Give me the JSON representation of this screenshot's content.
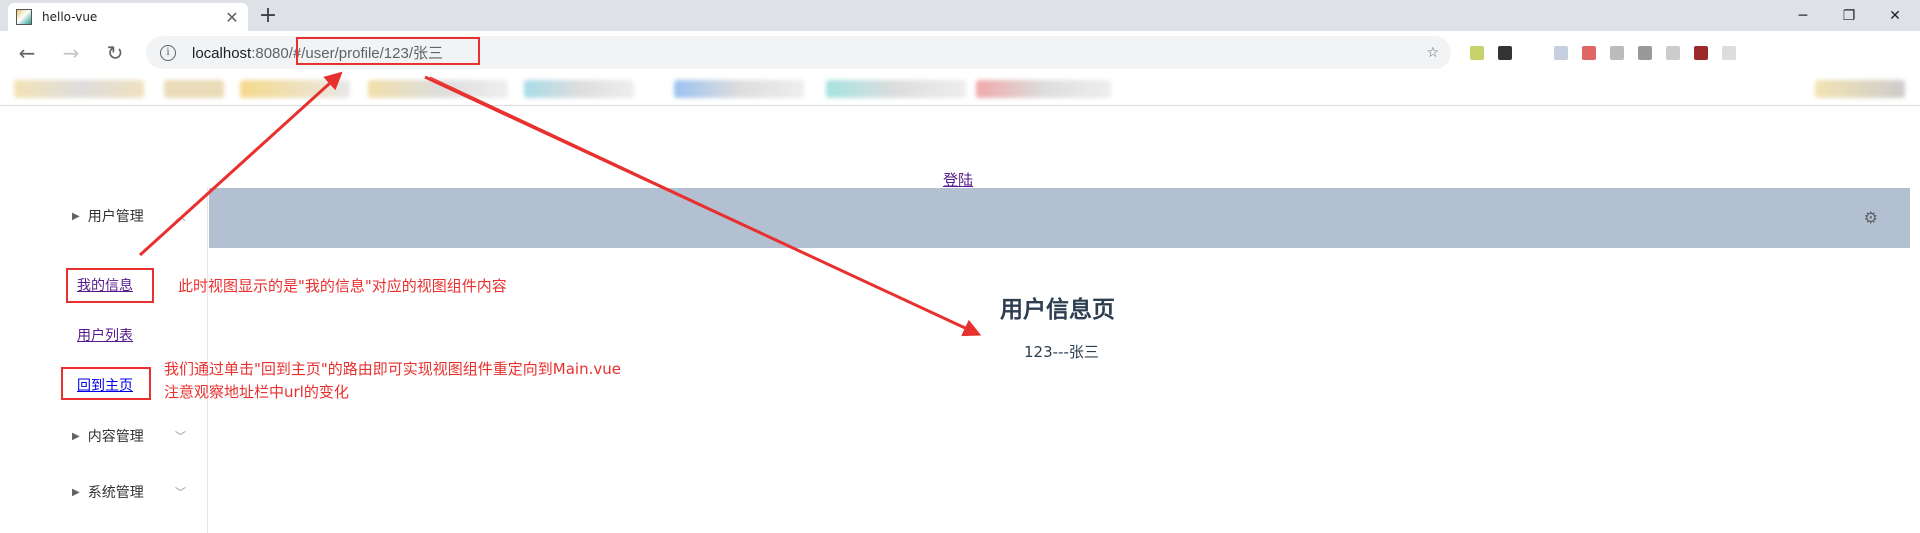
{
  "browser": {
    "tab_title": "hello-vue",
    "tab_close": "✕",
    "new_tab": "+",
    "window_minimize": "─",
    "window_restore": "❐",
    "window_close": "✕",
    "back": "←",
    "forward": "→",
    "reload": "↻",
    "info": "i",
    "url_host": "localhost",
    "url_port": ":8080/",
    "url_path": "#/user/profile/123/张三",
    "bookmark_star": "☆"
  },
  "app": {
    "login_link": "登陆",
    "sidebar": {
      "groups": [
        {
          "label": "用户管理",
          "expanded": true
        },
        {
          "label": "内容管理",
          "expanded": false
        },
        {
          "label": "系统管理",
          "expanded": false
        }
      ],
      "links": [
        {
          "label": "我的信息"
        },
        {
          "label": "用户列表"
        },
        {
          "label": "回到主页"
        }
      ]
    },
    "header": {
      "settings_icon": "⚙",
      "color": "#b3c0d1"
    },
    "main": {
      "title": "用户信息页",
      "value": "123---张三"
    }
  },
  "annotations": {
    "note_view": "此时视图显示的是\"我的信息\"对应的视图组件内容",
    "note_redirect_line1": "我们通过单击\"回到主页\"的路由即可实现视图组件重定向到Main.vue",
    "note_redirect_line2": "注意观察地址栏中url的变化",
    "color": "#e8312f"
  }
}
